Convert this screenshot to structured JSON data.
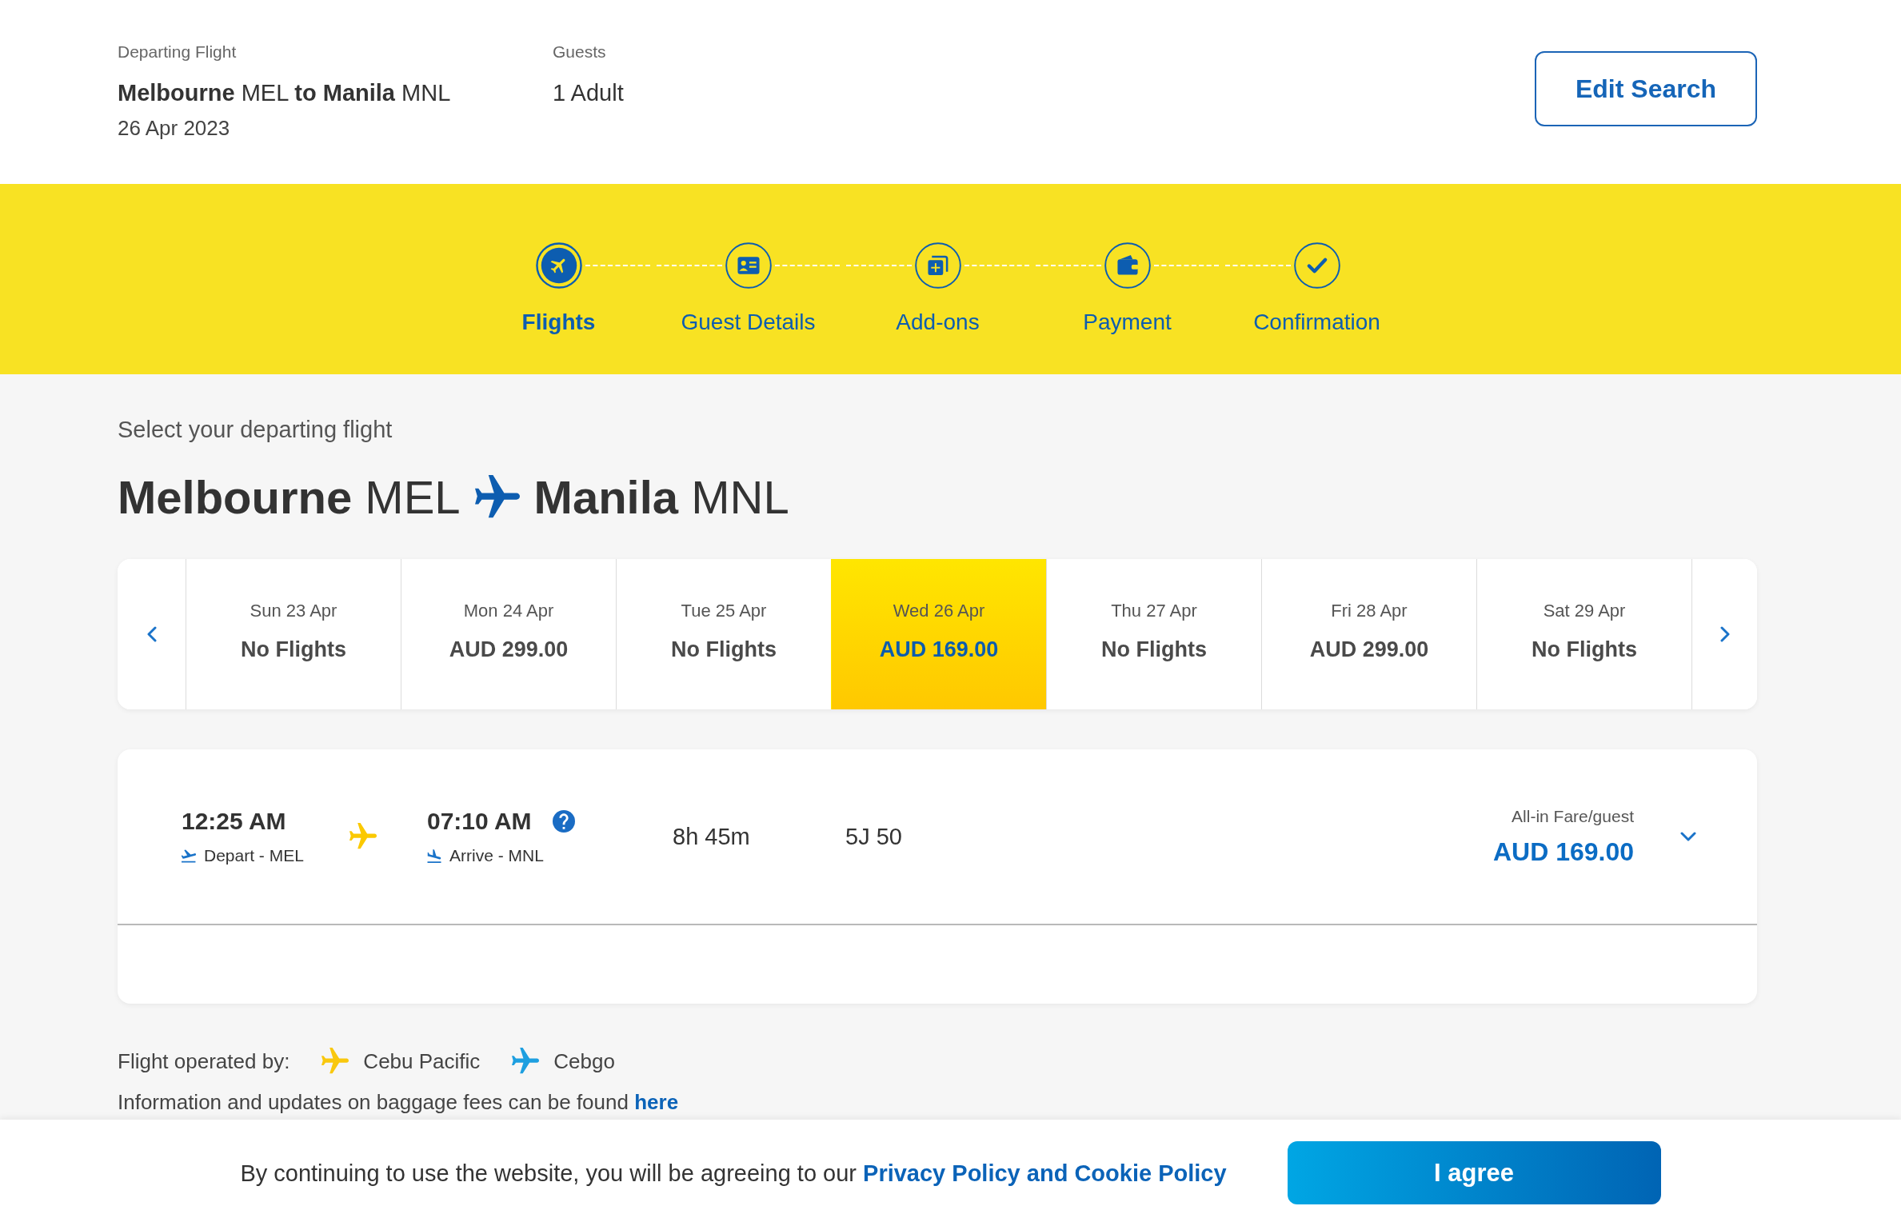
{
  "search": {
    "departing_label": "Departing Flight",
    "route": "**Melbourne** MEL **to Manila** MNL",
    "date": "26 Apr 2023",
    "guests_label": "Guests",
    "guests": "1 Adult",
    "edit_button": "Edit Search"
  },
  "steps": [
    {
      "label": "Flights",
      "selected": true
    },
    {
      "label": "Guest Details",
      "selected": false
    },
    {
      "label": "Add-ons",
      "selected": false
    },
    {
      "label": "Payment",
      "selected": false
    },
    {
      "label": "Confirmation",
      "selected": false
    }
  ],
  "heading": {
    "subtitle": "Select your departing flight",
    "origin": "**Melbourne** MEL",
    "destination": "**Manila** MNL"
  },
  "dates": [
    {
      "day": "Sun 23 Apr",
      "fare": "No Flights",
      "selected": false
    },
    {
      "day": "Mon 24 Apr",
      "fare": "AUD 299.00",
      "selected": false
    },
    {
      "day": "Tue 25 Apr",
      "fare": "No Flights",
      "selected": false
    },
    {
      "day": "Wed 26 Apr",
      "fare": "AUD 169.00",
      "selected": true
    },
    {
      "day": "Thu 27 Apr",
      "fare": "No Flights",
      "selected": false
    },
    {
      "day": "Fri 28 Apr",
      "fare": "AUD 299.00",
      "selected": false
    },
    {
      "day": "Sat 29 Apr",
      "fare": "No Flights",
      "selected": false
    }
  ],
  "flight": {
    "depart_time": "12:25 AM",
    "depart_label": "Depart - MEL",
    "arrive_time": "07:10 AM",
    "arrive_label": "Arrive - MNL",
    "duration": "8h 45m",
    "flight_number": "5J 50",
    "fare_label": "All-in Fare/guest",
    "fare": "AUD 169.00",
    "expanded": false
  },
  "operators": {
    "label": "Flight operated by:",
    "items": [
      {
        "name": "Cebu Pacific",
        "color": "#f9c80e"
      },
      {
        "name": "Cebgo",
        "color": "#1e9fe0"
      }
    ]
  },
  "baggage": {
    "text": "Information and updates on baggage fees can be found",
    "link": "here"
  },
  "cookie_banner": {
    "text": "By continuing to use the website, you will be agreeing to our",
    "link": "Privacy Policy and Cookie Policy",
    "button": "I agree"
  }
}
